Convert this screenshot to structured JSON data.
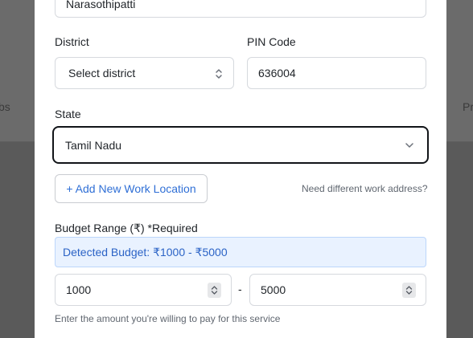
{
  "background": {
    "left_text": "bs",
    "right_text": "Pr"
  },
  "address": {
    "value": "Narasothipatti"
  },
  "district": {
    "label": "District",
    "selected": "Select district",
    "icon": "updown-chevron-icon"
  },
  "pin": {
    "label": "PIN Code",
    "value": "636004"
  },
  "state": {
    "label": "State",
    "selected": "Tamil Nadu",
    "icon": "chevron-down-icon"
  },
  "work_location": {
    "add_button": "+ Add New Work Location",
    "hint": "Need different work address?"
  },
  "budget": {
    "label": "Budget Range (₹) *Required",
    "detected": "Detected Budget: ₹1000 - ₹5000",
    "min_value": "1000",
    "max_value": "5000",
    "separator": "-",
    "helper": "Enter the amount you're willing to pay for this service"
  },
  "colors": {
    "accent": "#2f6fd6",
    "detected_bg": "#e9f2ff",
    "overlay": "#5a5a5a"
  }
}
